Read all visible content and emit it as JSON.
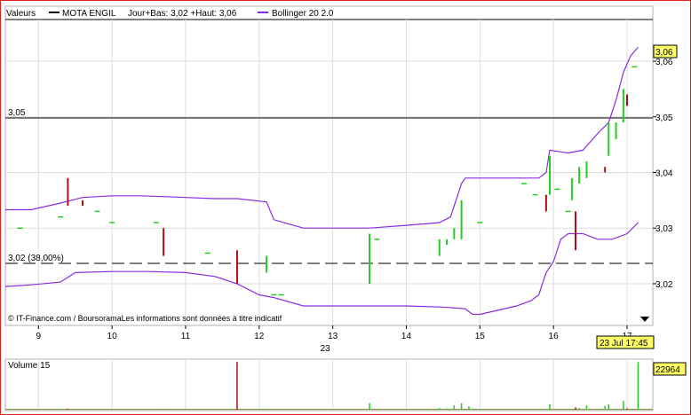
{
  "legend": {
    "valeurs_label": "Valeurs",
    "series_name": "MOTA ENGIL",
    "series_stats": "Jour+Bas: 3,02 +Haut: 3,06",
    "bollinger_name": "Bollinger 20 2.0"
  },
  "colors": {
    "frame": "#e0201a",
    "up_bar": "#22cc22",
    "down_bar": "#aa1111",
    "bollinger": "#8a2be2",
    "badge_bg": "#ffff66",
    "grid": "#dddddd"
  },
  "reference_lines": {
    "level_305": "3,05",
    "level_302": "3,02 (38,00%)"
  },
  "price_badge": "3,06",
  "time_badge": "23 Jul 17:45",
  "volume_badge": "22964",
  "volume_title": "Volume 15",
  "source_note": "© IT-Finance.com / BoursoramaLes informations sont données à titre indicatif",
  "x_axis": {
    "hour_labels": [
      "9",
      "10",
      "11",
      "12",
      "13",
      "14",
      "15",
      "16",
      "17"
    ],
    "date_label": "23"
  },
  "chart_data": [
    {
      "type": "line",
      "title": "MOTA ENGIL",
      "subtitle": "Jour+Bas: 3,02 +Haut: 3,06",
      "x_unit": "hour of day (23 Jul)",
      "xlim": [
        8.55,
        17.35
      ],
      "ylim": [
        3.0125,
        3.0675
      ],
      "y_ticks": [
        "3,02",
        "3,03",
        "3,04",
        "3,05",
        "3,06"
      ],
      "horizontal_lines": [
        {
          "value": 3.047,
          "label": "3,05",
          "style": "solid"
        },
        {
          "value": 3.022,
          "label": "3,02 (38,00%)",
          "style": "dashed"
        }
      ],
      "bars": [
        {
          "x": 8.75,
          "open": 3.03,
          "close": 3.03,
          "color": "up"
        },
        {
          "x": 9.3,
          "open": 3.032,
          "close": 3.032,
          "color": "up"
        },
        {
          "x": 9.4,
          "open": 3.039,
          "close": 3.034,
          "color": "down"
        },
        {
          "x": 9.6,
          "open": 3.035,
          "close": 3.034,
          "color": "down"
        },
        {
          "x": 9.8,
          "open": 3.033,
          "close": 3.033,
          "color": "up"
        },
        {
          "x": 10.0,
          "open": 3.031,
          "close": 3.031,
          "color": "up"
        },
        {
          "x": 10.6,
          "open": 3.031,
          "close": 3.031,
          "color": "up"
        },
        {
          "x": 10.7,
          "open": 3.03,
          "close": 3.025,
          "color": "down"
        },
        {
          "x": 11.3,
          "open": 3.0255,
          "close": 3.0255,
          "color": "up"
        },
        {
          "x": 11.7,
          "open": 3.026,
          "close": 3.02,
          "color": "down"
        },
        {
          "x": 12.1,
          "open": 3.022,
          "close": 3.025,
          "color": "up"
        },
        {
          "x": 12.2,
          "open": 3.018,
          "close": 3.018,
          "color": "up"
        },
        {
          "x": 12.3,
          "open": 3.018,
          "close": 3.018,
          "color": "up"
        },
        {
          "x": 13.5,
          "open": 3.02,
          "close": 3.029,
          "color": "up"
        },
        {
          "x": 13.6,
          "open": 3.028,
          "close": 3.028,
          "color": "up"
        },
        {
          "x": 14.45,
          "open": 3.025,
          "close": 3.028,
          "color": "up"
        },
        {
          "x": 14.55,
          "open": 3.027,
          "close": 3.028,
          "color": "up"
        },
        {
          "x": 14.65,
          "open": 3.028,
          "close": 3.03,
          "color": "up"
        },
        {
          "x": 14.75,
          "open": 3.028,
          "close": 3.035,
          "color": "up"
        },
        {
          "x": 15.0,
          "open": 3.031,
          "close": 3.031,
          "color": "up"
        },
        {
          "x": 15.6,
          "open": 3.038,
          "close": 3.038,
          "color": "up"
        },
        {
          "x": 15.75,
          "open": 3.036,
          "close": 3.036,
          "color": "up"
        },
        {
          "x": 15.9,
          "open": 3.036,
          "close": 3.033,
          "color": "down"
        },
        {
          "x": 15.95,
          "open": 3.036,
          "close": 3.043,
          "color": "up"
        },
        {
          "x": 16.05,
          "open": 3.037,
          "close": 3.037,
          "color": "up"
        },
        {
          "x": 16.2,
          "open": 3.033,
          "close": 3.033,
          "color": "up"
        },
        {
          "x": 16.25,
          "open": 3.035,
          "close": 3.039,
          "color": "up"
        },
        {
          "x": 16.3,
          "open": 3.033,
          "close": 3.026,
          "color": "down"
        },
        {
          "x": 16.35,
          "open": 3.038,
          "close": 3.041,
          "color": "up"
        },
        {
          "x": 16.45,
          "open": 3.039,
          "close": 3.042,
          "color": "up"
        },
        {
          "x": 16.7,
          "open": 3.041,
          "close": 3.04,
          "color": "down"
        },
        {
          "x": 16.75,
          "open": 3.043,
          "close": 3.049,
          "color": "up"
        },
        {
          "x": 16.85,
          "open": 3.046,
          "close": 3.049,
          "color": "up"
        },
        {
          "x": 16.95,
          "open": 3.049,
          "close": 3.055,
          "color": "up"
        },
        {
          "x": 17.0,
          "open": 3.054,
          "close": 3.052,
          "color": "down"
        },
        {
          "x": 17.1,
          "open": 3.059,
          "close": 3.059,
          "color": "up"
        }
      ],
      "series": [
        {
          "name": "Bollinger 20 2.0 (haute)",
          "x": [
            8.55,
            8.9,
            9.3,
            9.6,
            10.0,
            10.4,
            11.0,
            11.4,
            11.7,
            12.1,
            12.2,
            12.6,
            13.0,
            13.5,
            14.0,
            14.45,
            14.6,
            14.7,
            14.75,
            14.8,
            15.0,
            15.5,
            15.8,
            15.9,
            15.95,
            16.2,
            16.4,
            16.6,
            16.75,
            16.85,
            16.95,
            17.05,
            17.15
          ],
          "values": [
            3.0333,
            3.0333,
            3.0345,
            3.0355,
            3.0358,
            3.0358,
            3.0355,
            3.0353,
            3.0353,
            3.0347,
            3.0315,
            3.03,
            3.03,
            3.03,
            3.0305,
            3.031,
            3.032,
            3.036,
            3.038,
            3.039,
            3.039,
            3.039,
            3.039,
            3.04,
            3.044,
            3.0435,
            3.044,
            3.047,
            3.049,
            3.053,
            3.058,
            3.061,
            3.0625
          ]
        },
        {
          "name": "Bollinger 20 2.0 (basse)",
          "x": [
            8.55,
            8.9,
            9.3,
            9.5,
            10.0,
            10.5,
            11.0,
            11.4,
            11.7,
            12.0,
            12.2,
            12.6,
            13.0,
            13.5,
            14.0,
            14.5,
            14.8,
            14.9,
            15.0,
            15.5,
            15.7,
            15.8,
            15.9,
            16.0,
            16.1,
            16.2,
            16.4,
            16.6,
            16.8,
            17.0,
            17.15
          ],
          "values": [
            3.0195,
            3.0198,
            3.0203,
            3.022,
            3.0222,
            3.0222,
            3.022,
            3.0213,
            3.02,
            3.018,
            3.0175,
            3.016,
            3.016,
            3.016,
            3.016,
            3.0158,
            3.0155,
            3.0145,
            3.0145,
            3.016,
            3.017,
            3.018,
            3.022,
            3.024,
            3.028,
            3.029,
            3.029,
            3.028,
            3.028,
            3.029,
            3.031
          ]
        }
      ]
    },
    {
      "type": "bar",
      "title": "Volume 15",
      "x_unit": "hour of day (23 Jul)",
      "xlim": [
        8.55,
        17.35
      ],
      "ylim": [
        0,
        23500
      ],
      "last_value": 22964,
      "bars": [
        {
          "x": 9.4,
          "value": 900,
          "color": "down"
        },
        {
          "x": 10.7,
          "value": 500,
          "color": "down"
        },
        {
          "x": 11.7,
          "value": 23000,
          "color": "down"
        },
        {
          "x": 12.1,
          "value": 600,
          "color": "up"
        },
        {
          "x": 13.5,
          "value": 3500,
          "color": "up"
        },
        {
          "x": 14.45,
          "value": 1200,
          "color": "up"
        },
        {
          "x": 14.55,
          "value": 1000,
          "color": "up"
        },
        {
          "x": 14.65,
          "value": 2500,
          "color": "up"
        },
        {
          "x": 14.75,
          "value": 3500,
          "color": "up"
        },
        {
          "x": 14.85,
          "value": 2000,
          "color": "up"
        },
        {
          "x": 15.0,
          "value": 800,
          "color": "up"
        },
        {
          "x": 15.95,
          "value": 3000,
          "color": "up"
        },
        {
          "x": 16.3,
          "value": 1500,
          "color": "down"
        },
        {
          "x": 16.35,
          "value": 1200,
          "color": "up"
        },
        {
          "x": 16.45,
          "value": 2500,
          "color": "up"
        },
        {
          "x": 16.7,
          "value": 2200,
          "color": "up"
        },
        {
          "x": 16.75,
          "value": 3000,
          "color": "up"
        },
        {
          "x": 16.95,
          "value": 4500,
          "color": "up"
        },
        {
          "x": 17.0,
          "value": 1000,
          "color": "down"
        },
        {
          "x": 17.15,
          "value": 22964,
          "color": "up"
        }
      ],
      "baseline": 600
    }
  ]
}
